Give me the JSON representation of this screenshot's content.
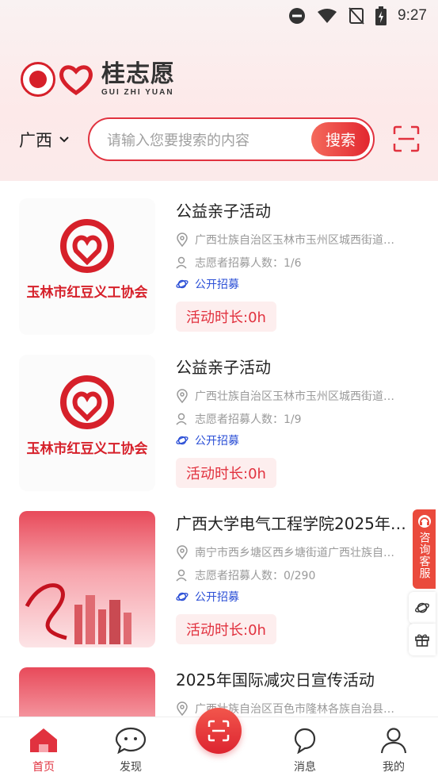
{
  "status_bar": {
    "time": "9:27"
  },
  "brand": {
    "name_cn": "桂志愿",
    "name_en": "GUI ZHI YUAN"
  },
  "search": {
    "region": "广西",
    "placeholder": "请输入您要搜索的内容",
    "button_label": "搜索"
  },
  "activities": [
    {
      "title": "公益亲子活动",
      "location": "广西壮族自治区玉林市玉州区城西街道…",
      "recruit_count": "志愿者招募人数：1/6",
      "recruit_type": "公开招募",
      "duration": "活动时长:0h",
      "thumb_text": "玉林市红豆义工协会"
    },
    {
      "title": "公益亲子活动",
      "location": "广西壮族自治区玉林市玉州区城西街道…",
      "recruit_count": "志愿者招募人数：1/9",
      "recruit_type": "公开招募",
      "duration": "活动时长:0h",
      "thumb_text": "玉林市红豆义工协会"
    },
    {
      "title": "广西大学电气工程学院2025年…",
      "location": "南宁市西乡塘区西乡塘街道广西壮族自…",
      "recruit_count": "志愿者招募人数：0/290",
      "recruit_type": "公开招募",
      "duration": "活动时长:0h"
    },
    {
      "title": "2025年国际减灾日宣传活动",
      "location": "广西壮族自治区百色市隆林各族自治县…"
    }
  ],
  "side": {
    "consult_label": "咨询客服"
  },
  "tabbar": {
    "home": "首页",
    "discover": "发现",
    "messages": "消息",
    "mine": "我的"
  },
  "colors": {
    "accent": "#e1323f",
    "recruit": "#2b4fd6"
  }
}
